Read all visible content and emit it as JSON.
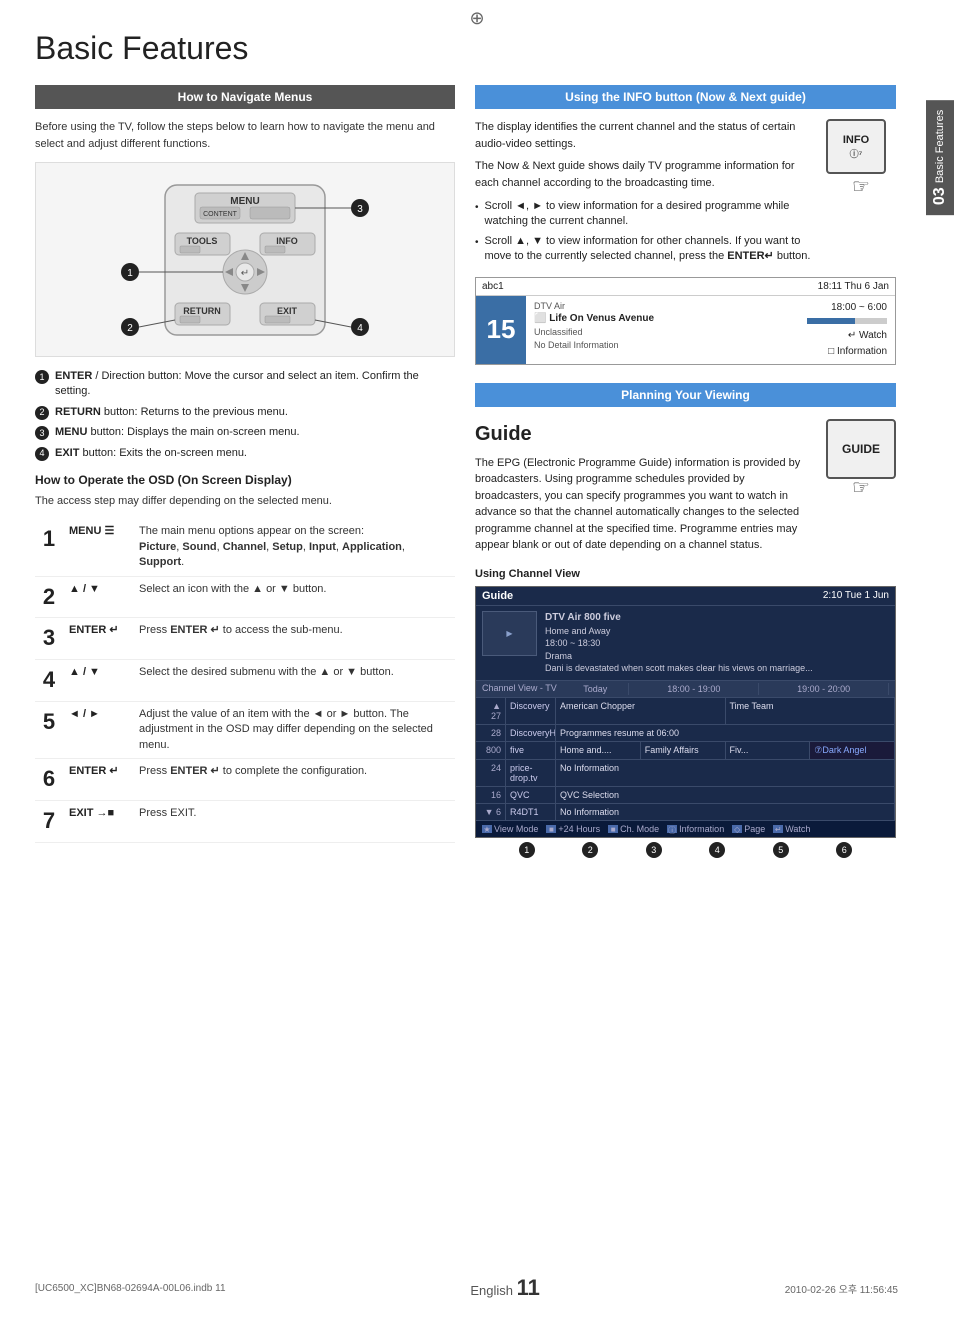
{
  "page": {
    "title": "Basic Features",
    "side_chapter": "03",
    "side_label": "Basic Features",
    "footer_file": "[UC6500_XC]BN68-02694A-00L06.indb   11",
    "footer_date": "2010-02-26   오후  11:56:45",
    "page_number": "11",
    "page_lang": "English"
  },
  "left_column": {
    "section1_header": "How to Navigate Menus",
    "intro": "Before using the TV, follow the steps below to learn how to navigate the menu and select and adjust different functions.",
    "numbered_items": [
      {
        "num": "1",
        "label": "ENTER",
        "suffix": " / Direction button: Move the cursor and select an item. Confirm the setting."
      },
      {
        "num": "2",
        "label": "RETURN",
        "suffix": " button: Returns to the previous menu."
      },
      {
        "num": "3",
        "label": "MENU",
        "suffix": " button: Displays the main on-screen menu."
      },
      {
        "num": "4",
        "label": "EXIT",
        "suffix": " button: Exits the on-screen menu."
      }
    ],
    "osd_title": "How to Operate the OSD (On Screen Display)",
    "osd_intro": "The access step may differ depending on the selected menu.",
    "osd_rows": [
      {
        "num": "1",
        "key": "MENU ☰",
        "desc": "The main menu options appear on the screen:",
        "bold_items": "Picture, Sound, Channel, Setup, Input, Application, Support."
      },
      {
        "num": "2",
        "key": "▲ / ▼",
        "desc": "Select an icon with the ▲ or ▼ button."
      },
      {
        "num": "3",
        "key": "ENTER ↵",
        "desc": "Press ENTER ↵ to access the sub-menu."
      },
      {
        "num": "4",
        "key": "▲ / ▼",
        "desc": "Select the desired submenu with the ▲ or ▼ button."
      },
      {
        "num": "5",
        "key": "◄ / ►",
        "desc": "Adjust the value of an item with the ◄ or ► button. The adjustment in the OSD may differ depending on the selected menu."
      },
      {
        "num": "6",
        "key": "ENTER ↵",
        "desc": "Press ENTER ↵ to complete the configuration."
      },
      {
        "num": "7",
        "key": "EXIT →■",
        "desc": "Press EXIT."
      }
    ]
  },
  "right_column": {
    "info_header": "Using the INFO button (Now & Next guide)",
    "info_paragraphs": [
      "The display identifies the current channel and the status of certain audio-video settings.",
      "The Now & Next guide shows daily TV programme information for each channel according to the broadcasting time."
    ],
    "info_bullets": [
      "Scroll ◄, ► to view information for a desired programme while watching the current channel.",
      "Scroll ▲, ▼ to view information for other channels. If you want to move to the currently selected channel, press the ENTER↵ button."
    ],
    "info_button_label": "INFO",
    "channel_info": {
      "channel_name": "abc1",
      "time_label": "18:11 Thu 6 Jan",
      "channel_type": "DTV Air",
      "programme": "Life On Venus Avenue",
      "time_range": "18:00 ~ 6:00",
      "channel_num": "15",
      "classification": "Unclassified",
      "no_detail": "No Detail Information",
      "watch": "▶ Watch",
      "information": "□ Information"
    },
    "planning_header": "Planning Your Viewing",
    "guide_title": "Guide",
    "guide_button_label": "GUIDE",
    "guide_text": "The EPG (Electronic Programme Guide) information is provided by broadcasters. Using programme schedules provided by broadcasters, you can specify programmes you want to watch in advance so that the channel automatically changes to the selected programme channel at the specified time. Programme entries may appear blank or out of date depending on a channel status.",
    "channel_view_title": "Using  Channel View",
    "guide_box": {
      "header_title": "Guide",
      "header_time": "2:10 Tue 1 Jun",
      "preview_title": "DTV Air 800 five",
      "preview_subtitle": "Home and Away",
      "preview_time": "18:00 ~ 18:30",
      "preview_genre": "Drama",
      "preview_desc": "Dani is devastated when scott makes clear his views on marriage...",
      "channels_label": "Channel View - TV",
      "time_cols": [
        "18:00 - 19:00",
        "19:00 - 20:00"
      ],
      "rows": [
        {
          "num": "▲ 27",
          "name": "Discovery",
          "prog1": "American Chopper",
          "prog2": "Time Team",
          "highlight": false
        },
        {
          "num": "28",
          "name": "DiscoveryH&L",
          "prog1": "Programmes resume at 06:00",
          "prog2": "",
          "highlight": false
        },
        {
          "num": "800",
          "name": "five",
          "prog1": "Home and....",
          "prog2": "Family Affairs   Fiv...   ⑦Dark Angel",
          "highlight": false
        },
        {
          "num": "24",
          "name": "price-drop.tv",
          "prog1": "No Information",
          "prog2": "",
          "highlight": false
        },
        {
          "num": "16",
          "name": "QVC",
          "prog1": "QVC Selection",
          "prog2": "",
          "highlight": false
        },
        {
          "num": "▼ 6",
          "name": "R4DT1",
          "prog1": "No Information",
          "prog2": "",
          "highlight": false
        }
      ],
      "footer_items": [
        "★ View Mode",
        "■ +24 Hours",
        "■ Ch. Mode",
        "ⓘ Information",
        "◇ Page",
        "↵ Watch"
      ],
      "foot_numbers": [
        "❶",
        "❷",
        "❸",
        "❹",
        "❺",
        "❻"
      ]
    }
  }
}
